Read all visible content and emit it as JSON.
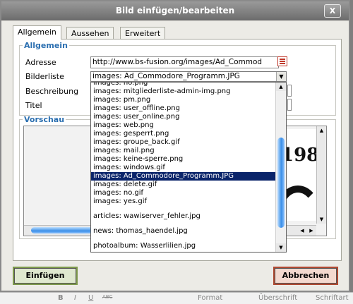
{
  "dialog": {
    "title": "Bild einfügen/bearbeiten",
    "close_label": "X"
  },
  "tabs": [
    {
      "label": "Allgemein",
      "active": true
    },
    {
      "label": "Aussehen",
      "active": false
    },
    {
      "label": "Erweitert",
      "active": false
    }
  ],
  "general": {
    "legend": "Allgemein",
    "address_label": "Adresse",
    "address_value": "http://www.bs-fusion.org/images/Ad_Commod",
    "imagelist_label": "Bilderliste",
    "imagelist_value": "images: Ad_Commodore_Programm.JPG",
    "description_label": "Beschreibung",
    "title_label": "Titel"
  },
  "preview": {
    "legend": "Vorschau",
    "image_text": "198"
  },
  "dropdown": {
    "options": [
      {
        "label": "images: no.png"
      },
      {
        "label": "images: mitgliederliste-admin-img.png"
      },
      {
        "label": "images: pm.png"
      },
      {
        "label": "images: user_offline.png"
      },
      {
        "label": "images: user_online.png"
      },
      {
        "label": "images: web.png"
      },
      {
        "label": "images: gesperrt.png"
      },
      {
        "label": "images: groupe_back.gif"
      },
      {
        "label": "images: mail.png"
      },
      {
        "label": "images: keine-sperre.png"
      },
      {
        "label": "images: windows.gif"
      },
      {
        "label": "images: Ad_Commodore_Programm.JPG",
        "selected": true
      },
      {
        "label": "images: delete.gif"
      },
      {
        "label": "images: no.gif"
      },
      {
        "label": "images: yes.gif"
      },
      {
        "label": "",
        "gap": true
      },
      {
        "label": "articles: wawiserver_fehler.jpg"
      },
      {
        "label": "",
        "gap": true
      },
      {
        "label": "news: thomas_haendel.jpg"
      },
      {
        "label": "",
        "gap": true
      },
      {
        "label": "photoalbum: Wasserlilien.jpg"
      }
    ]
  },
  "buttons": {
    "insert": "Einfügen",
    "cancel": "Abbrechen"
  },
  "editor_toolbar": {
    "bold": "B",
    "italic": "I",
    "underline": "U",
    "strike": "ABC",
    "format": "Format",
    "heading": "Überschrift",
    "font": "Schriftart"
  },
  "colors": {
    "legend": "#2b6fb0",
    "selected_bg": "#0a246a",
    "insert_border": "#7e9a4c",
    "cancel_border": "#b04a32"
  }
}
